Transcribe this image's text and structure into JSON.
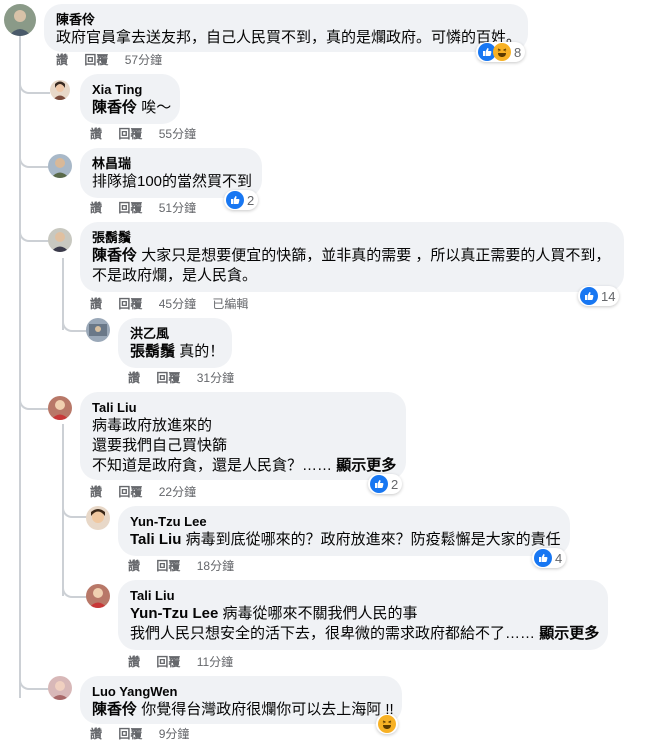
{
  "common": {
    "like": "讚",
    "reply": "回覆",
    "edited": "已編輯",
    "see_more": "顯示更多"
  },
  "comments": [
    {
      "name": "陳香伶",
      "text": "政府官員拿去送友邦，自己人民買不到，真的是爛政府。可憐的百姓。",
      "time": "57分鐘",
      "reactions": "8"
    },
    {
      "name": "Xia Ting",
      "mention": "陳香伶",
      "text": "唉～",
      "time": "55分鐘"
    },
    {
      "name": "林昌瑞",
      "text": "排隊搶100的當然買不到",
      "time": "51分鐘",
      "reactions": "2"
    },
    {
      "name": "張鬍鬚",
      "mention": "陳香伶",
      "text": "大家只是想要便宜的快篩，並非真的需要 ，所以真正需要的人買不到，",
      "text2": "不是政府爛，是人民貪。",
      "time": "45分鐘",
      "reactions": "14"
    },
    {
      "name": "洪乙風",
      "mention": "張鬍鬚",
      "text": "真的！",
      "time": "31分鐘"
    },
    {
      "name": "Tali Liu",
      "text": "病毒政府放進來的",
      "text2": "還要我們自己買快篩",
      "text3": "不知道是政府貪，還是人民貪？……",
      "time": "22分鐘",
      "reactions": "2"
    },
    {
      "name": "Yun-Tzu Lee",
      "mention": "Tali Liu",
      "text": "病毒到底從哪來的？政府放進來？防疫鬆懈是大家的責任",
      "time": "18分鐘",
      "reactions": "4"
    },
    {
      "name": "Tali Liu",
      "mention": "Yun-Tzu Lee",
      "text": "病毒從哪來不關我們人民的事",
      "text2": "我們人民只想安全的活下去，很卑微的需求政府都給不了……",
      "time": "11分鐘"
    },
    {
      "name": "Luo YangWen",
      "mention": "陳香伶",
      "text": "你覺得台灣政府很爛你可以去上海阿 !!",
      "time": "9分鐘"
    }
  ],
  "colors": {
    "like": "#1877f2",
    "haha": "#f7b125",
    "bubble": "#f0f2f5"
  }
}
